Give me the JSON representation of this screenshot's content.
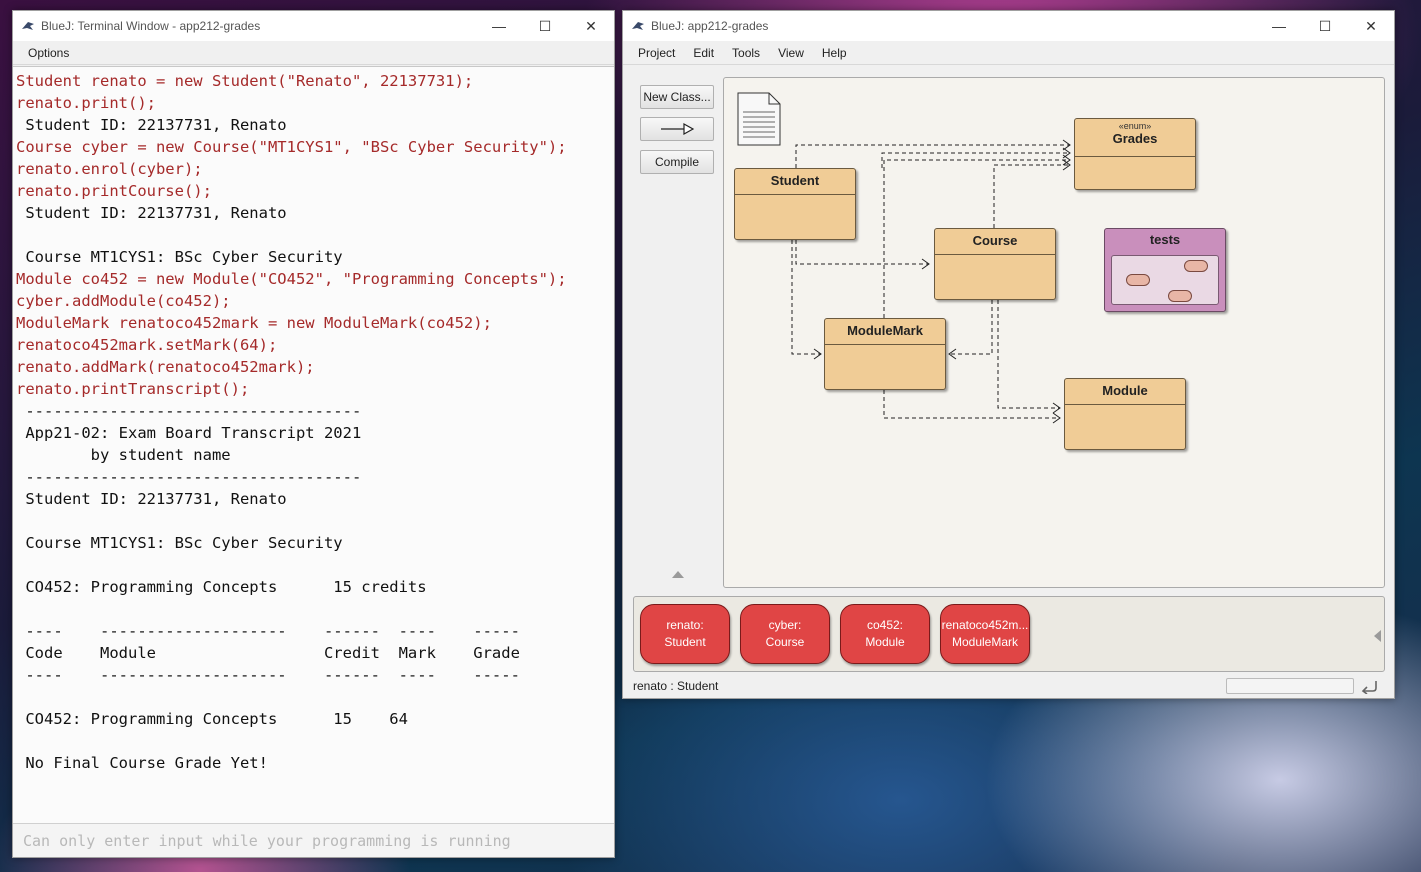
{
  "terminal": {
    "title": "BlueJ: Terminal Window - app212-grades",
    "menu": [
      "Options"
    ],
    "lines": [
      {
        "t": "Student renato = new Student(\"Renato\", 22137731);",
        "k": "input"
      },
      {
        "t": "renato.print();",
        "k": "input"
      },
      {
        "t": " Student ID: 22137731, Renato",
        "k": "output"
      },
      {
        "t": "Course cyber = new Course(\"MT1CYS1\", \"BSc Cyber Security\");",
        "k": "input"
      },
      {
        "t": "renato.enrol(cyber);",
        "k": "input"
      },
      {
        "t": "renato.printCourse();",
        "k": "input"
      },
      {
        "t": " Student ID: 22137731, Renato",
        "k": "output"
      },
      {
        "t": " ",
        "k": "output"
      },
      {
        "t": " Course MT1CYS1: BSc Cyber Security",
        "k": "output"
      },
      {
        "t": "Module co452 = new Module(\"CO452\", \"Programming Concepts\");",
        "k": "input"
      },
      {
        "t": "cyber.addModule(co452);",
        "k": "input"
      },
      {
        "t": "ModuleMark renatoco452mark = new ModuleMark(co452);",
        "k": "input"
      },
      {
        "t": "renatoco452mark.setMark(64);",
        "k": "input"
      },
      {
        "t": "renato.addMark(renatoco452mark);",
        "k": "input"
      },
      {
        "t": "renato.printTranscript();",
        "k": "input"
      },
      {
        "t": " ------------------------------------",
        "k": "output"
      },
      {
        "t": " App21-02: Exam Board Transcript 2021",
        "k": "output"
      },
      {
        "t": "        by student name",
        "k": "output"
      },
      {
        "t": " ------------------------------------",
        "k": "output"
      },
      {
        "t": " Student ID: 22137731, Renato",
        "k": "output"
      },
      {
        "t": " ",
        "k": "output"
      },
      {
        "t": " Course MT1CYS1: BSc Cyber Security",
        "k": "output"
      },
      {
        "t": " ",
        "k": "output"
      },
      {
        "t": " CO452: Programming Concepts      15 credits",
        "k": "output"
      },
      {
        "t": " ",
        "k": "output"
      },
      {
        "t": " ----    --------------------    ------  ----    -----",
        "k": "output"
      },
      {
        "t": " Code    Module                  Credit  Mark    Grade",
        "k": "output"
      },
      {
        "t": " ----    --------------------    ------  ----    -----",
        "k": "output"
      },
      {
        "t": " ",
        "k": "output"
      },
      {
        "t": " CO452: Programming Concepts      15    64",
        "k": "output"
      },
      {
        "t": " ",
        "k": "output"
      },
      {
        "t": " No Final Course Grade Yet!",
        "k": "output"
      }
    ],
    "input_placeholder": "Can only enter input while your programming is running"
  },
  "bluej": {
    "title": "BlueJ:  app212-grades",
    "menu": [
      "Project",
      "Edit",
      "Tools",
      "View",
      "Help"
    ],
    "buttons": {
      "new_class": "New Class...",
      "compile": "Compile"
    },
    "classes": {
      "grades": {
        "name": "Grades",
        "stereotype": "«enum»"
      },
      "student": {
        "name": "Student"
      },
      "course": {
        "name": "Course"
      },
      "tests": {
        "name": "tests"
      },
      "modulemark": {
        "name": "ModuleMark"
      },
      "module": {
        "name": "Module"
      }
    },
    "objects": [
      {
        "name": "renato:",
        "type": "Student"
      },
      {
        "name": "cyber:",
        "type": "Course"
      },
      {
        "name": "co452:",
        "type": "Module"
      },
      {
        "name": "renatoco452m...",
        "type": "ModuleMark"
      }
    ],
    "status": "renato : Student"
  },
  "colors": {
    "class_fill": "#f0cc96",
    "object_fill": "#e04545",
    "input_text": "#a52a2a",
    "tests_fill": "#c98fbc"
  }
}
